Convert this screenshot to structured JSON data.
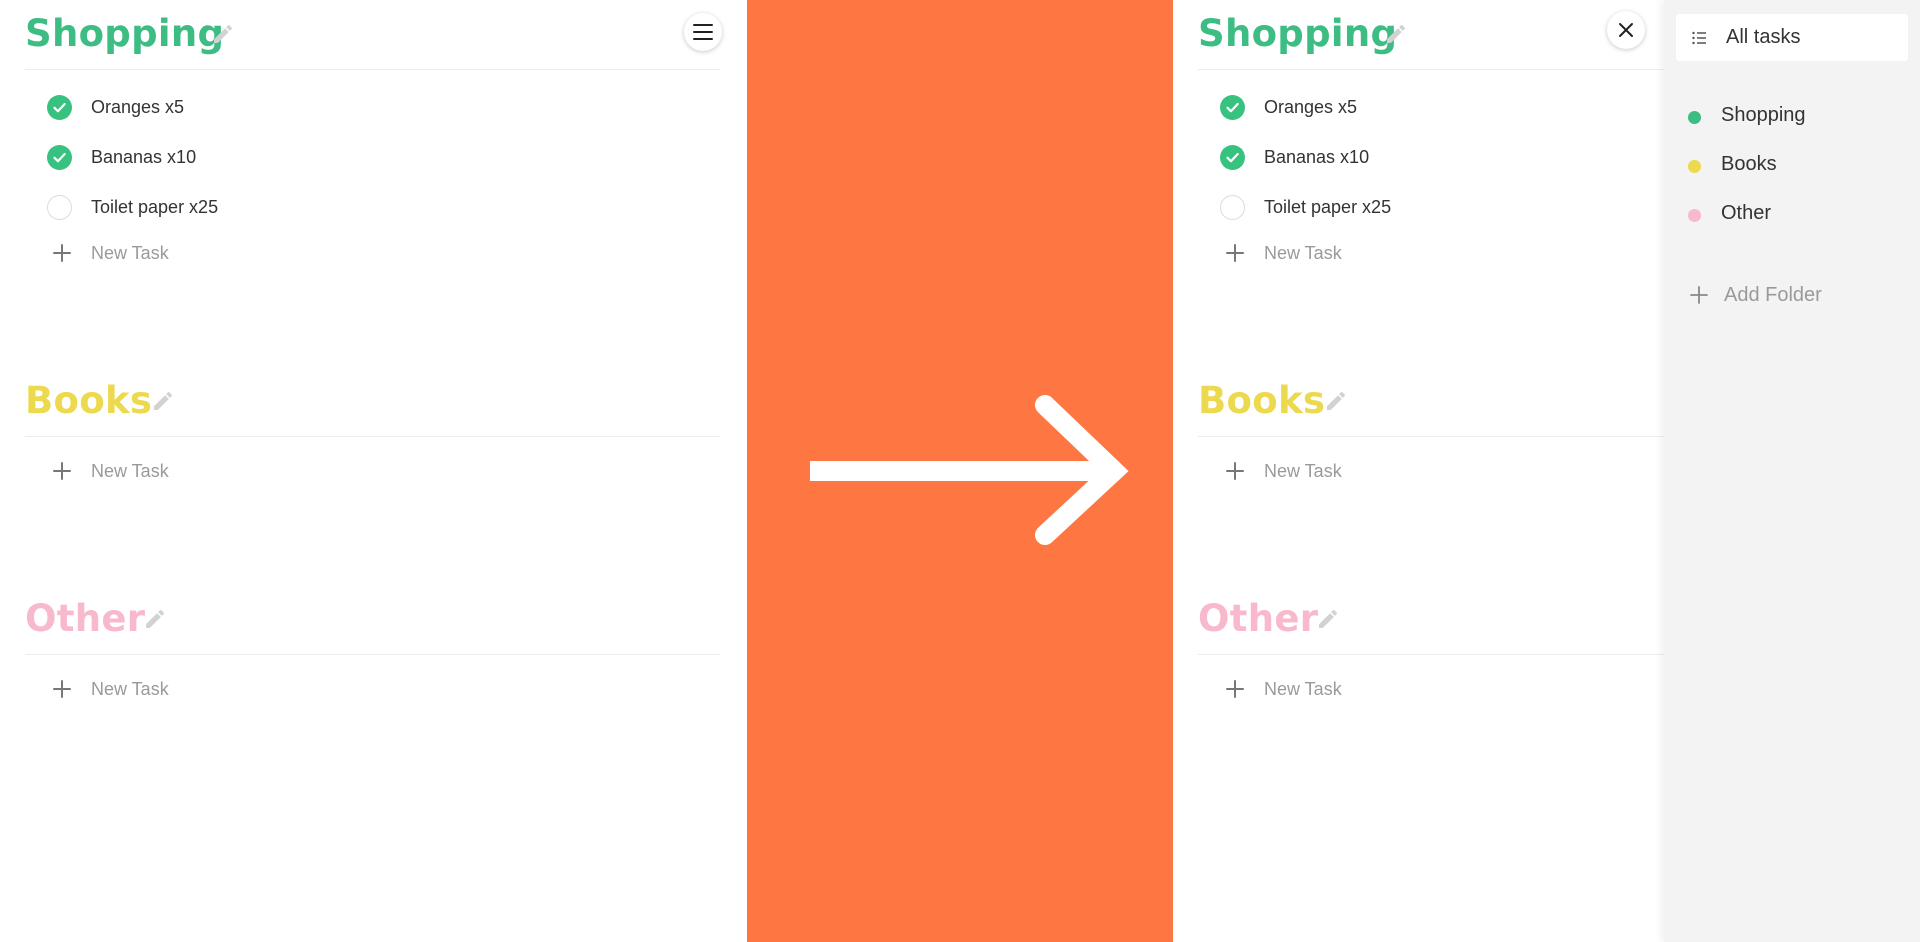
{
  "colors": {
    "divider_orange": "#fe7641",
    "shopping": "#3dbd84",
    "books": "#ecd94e",
    "other": "#f9b9cc",
    "done_check": "#38c27f"
  },
  "icons": {
    "menu": "hamburger-menu-icon",
    "close": "close-icon",
    "edit": "pencil-icon",
    "add": "plus-icon",
    "list": "list-icon",
    "arrow": "arrow-right-icon"
  },
  "folders": [
    {
      "title": "Shopping",
      "color": "#3dbd84",
      "tasks": [
        {
          "label": "Oranges x5",
          "done": true
        },
        {
          "label": "Bananas x10",
          "done": true
        },
        {
          "label": "Toilet paper x25",
          "done": false
        }
      ],
      "new_task_label": "New Task"
    },
    {
      "title": "Books",
      "color": "#ecd94e",
      "tasks": [],
      "new_task_label": "New Task"
    },
    {
      "title": "Other",
      "color": "#f9b9cc",
      "tasks": [],
      "new_task_label": "New Task"
    }
  ],
  "sidebar": {
    "all_tasks_label": "All tasks",
    "folders": [
      {
        "label": "Shopping",
        "color": "#3dbd84"
      },
      {
        "label": "Books",
        "color": "#ecd94e"
      },
      {
        "label": "Other",
        "color": "#f9b9cc"
      }
    ],
    "add_folder_label": "Add Folder"
  }
}
